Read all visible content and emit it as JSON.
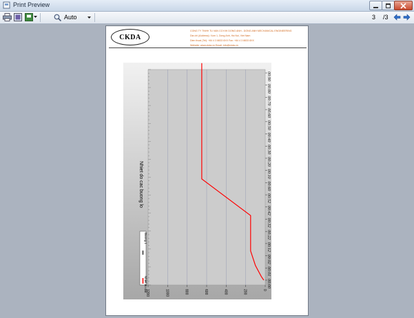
{
  "window": {
    "title": "Print Preview"
  },
  "toolbar": {
    "zoom_value": "Auto",
    "page_current": "3",
    "page_total": "/3",
    "icons": [
      "print-icon",
      "page-setup-icon",
      "export-icon",
      "zoom-icon",
      "previous-page-icon",
      "next-page-icon"
    ]
  },
  "report": {
    "logo_text": "CKDA",
    "company_lines": [
      "CONG TY TNHH TU VAN CO KHI DONG ANH - DONG ANH MECHANICAL ENGINEERING",
      "Dia chi (Address): Xom 1, Dong Anh, Ha Noi, Viet Nam",
      "Dien thoai (Tel): +84 4 3 8833 8XX  Fax: +84 4 3 8833 8XX",
      "Website: www.ckda.vn  Email: info@ckda.vn"
    ]
  },
  "chart_data": {
    "type": "line",
    "orientation": "rotated",
    "ylabel": "Nhiet do cac buong lo",
    "y_ticks": [
      0,
      200,
      400,
      600,
      800,
      1000,
      1200
    ],
    "ylim": [
      0,
      1200
    ],
    "x_ticks": [
      "00:00",
      "00:01",
      "00:02",
      "00:12",
      "00:22",
      "00:32",
      "00:42",
      "00:52",
      "00:60",
      "00:10",
      "00:20",
      "00:30",
      "00:40",
      "00:50",
      "00:60",
      "00:70",
      "00:80",
      "00:90"
    ],
    "grid": true,
    "legend_position": "bottom-left",
    "series": [
      {
        "name": "Buong 1",
        "color": "#ff0000",
        "x_index": [
          0,
          0.3,
          1.2,
          2.4,
          5.3,
          8.3,
          17.8
        ],
        "values": [
          15,
          40,
          100,
          150,
          150,
          650,
          650
        ]
      }
    ],
    "legend_entries": [
      "Nhiet do dat",
      "Buong 1"
    ]
  },
  "colors": {
    "plot_bg": "#cccccc",
    "series": "#ff0000",
    "company_text": "#d2691e"
  }
}
